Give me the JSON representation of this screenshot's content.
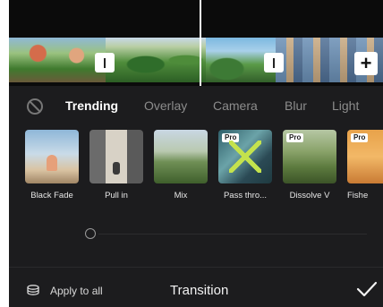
{
  "tabs": {
    "items": [
      "Trending",
      "Overlay",
      "Camera",
      "Blur",
      "Light"
    ],
    "active": "Trending"
  },
  "transitions": [
    {
      "label": "Black Fade",
      "pro": false
    },
    {
      "label": "Pull in",
      "pro": false
    },
    {
      "label": "Mix",
      "pro": false
    },
    {
      "label": "Pass thro...",
      "pro": true
    },
    {
      "label": "Dissolve V",
      "pro": true
    },
    {
      "label": "Fishe",
      "pro": true
    }
  ],
  "pro_badge": "Pro",
  "bottom": {
    "apply_all": "Apply to all",
    "title": "Transition"
  },
  "icons": {
    "none": "none-icon",
    "split": "split-icon",
    "add": "plus-icon",
    "apply_all": "stack-icon",
    "confirm": "checkmark-icon"
  }
}
